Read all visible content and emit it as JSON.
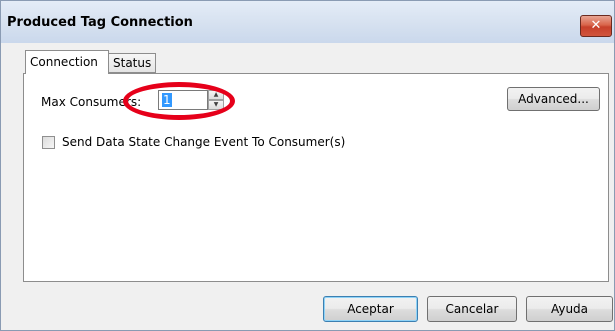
{
  "window": {
    "title": "Produced Tag Connection",
    "close_glyph": "✕"
  },
  "tabs": [
    {
      "label": "Connection",
      "active": true
    },
    {
      "label": "Status",
      "active": false
    }
  ],
  "connection": {
    "max_consumers_label": "Max Consumers:",
    "max_consumers_value": "1",
    "advanced_label": "Advanced...",
    "send_event_label": "Send Data State Change Event To Consumer(s)",
    "send_event_checked": false
  },
  "footer": {
    "ok_label": "Aceptar",
    "cancel_label": "Cancelar",
    "help_label": "Ayuda"
  },
  "icons": {
    "spin_up": "▲",
    "spin_down": "▼"
  },
  "colors": {
    "annotation": "#e6001a",
    "close_button": "#c7402a",
    "selection": "#3399ff"
  }
}
